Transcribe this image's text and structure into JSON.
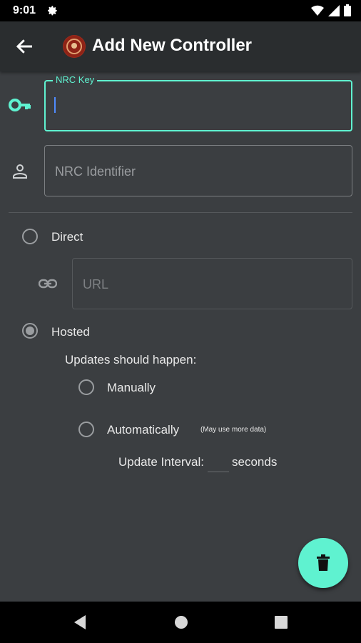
{
  "status_bar": {
    "time": "9:01"
  },
  "app_bar": {
    "title": "Add New Controller"
  },
  "form": {
    "nrc_key": {
      "label": "NRC Key",
      "value": ""
    },
    "nrc_identifier": {
      "placeholder": "NRC Identifier"
    },
    "direct": {
      "label": "Direct",
      "selected": false
    },
    "url": {
      "placeholder": "URL"
    },
    "hosted": {
      "label": "Hosted",
      "selected": true
    },
    "updates_heading": "Updates should happen:",
    "manually": {
      "label": "Manually",
      "selected": false
    },
    "automatically": {
      "label": "Automatically",
      "note": "(May use more data)",
      "selected": false
    },
    "update_interval": {
      "label": "Update Interval:",
      "value": "",
      "unit": "seconds"
    }
  },
  "colors": {
    "accent": "#5ff2d0",
    "background": "#3b3e41",
    "appbar": "#2a2d2f",
    "cursor": "#4f8cff"
  },
  "icons": [
    "settings-gear-icon",
    "wifi-icon",
    "signal-icon",
    "battery-icon",
    "back-arrow-icon",
    "app-logo",
    "key-icon",
    "person-icon",
    "link-icon",
    "trash-icon",
    "nav-back-icon",
    "nav-home-icon",
    "nav-recents-icon"
  ]
}
